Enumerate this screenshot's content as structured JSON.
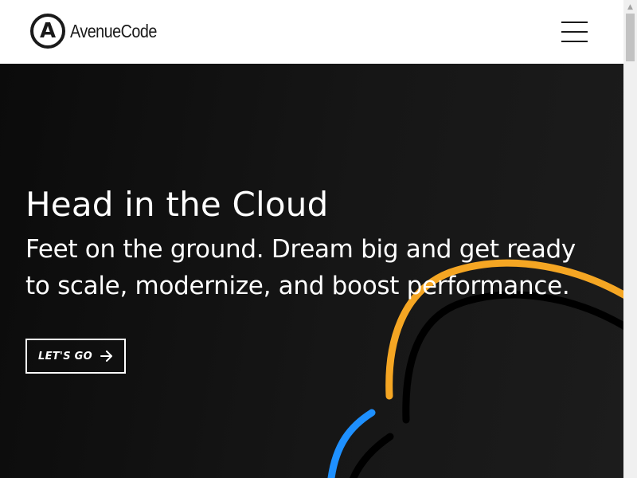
{
  "brand": {
    "logo_letter": "A",
    "logo_text": "AvenueCode"
  },
  "nav": {
    "menu_icon": "hamburger-menu-icon"
  },
  "hero": {
    "title": "Head in the Cloud",
    "subtitle": "Feet on the ground. Dream big and get ready to scale, modernize, and boost performance.",
    "cta_label": "LET'S GO",
    "cta_icon": "arrow-right-icon"
  },
  "colors": {
    "hero_background": "#141414",
    "accent_orange": "#f5a623",
    "accent_blue": "#1e90ff",
    "text": "#ffffff"
  }
}
